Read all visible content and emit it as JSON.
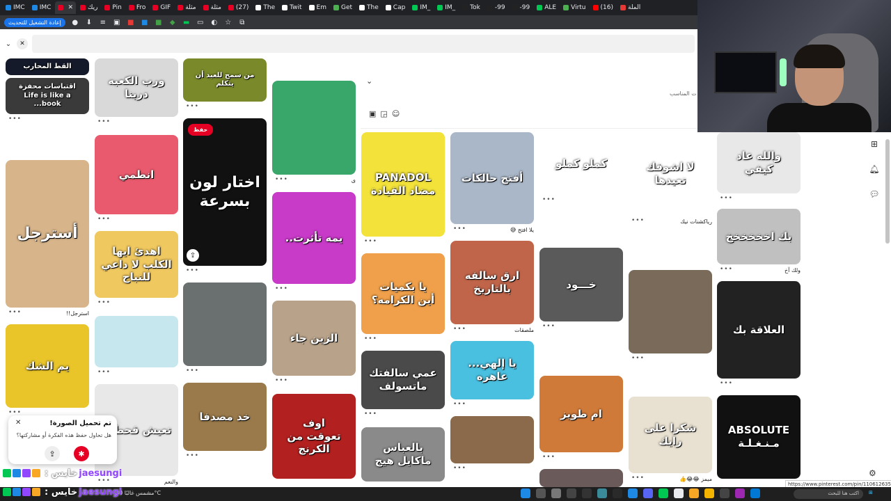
{
  "browser": {
    "tabs": [
      {
        "label": "الملة",
        "fav": "#e53935"
      },
      {
        "label": "(16)",
        "fav": "#ff0000"
      },
      {
        "label": "Virtu",
        "fav": "#4caf50"
      },
      {
        "label": "ALE",
        "fav": "#00c853"
      },
      {
        "label": "-99",
        "fav": "#222222"
      },
      {
        "label": "-99",
        "fav": "#222222"
      },
      {
        "label": "Tok",
        "fav": "#222222"
      },
      {
        "label": "IM_",
        "fav": "#00c853"
      },
      {
        "label": "IM_",
        "fav": "#00c853"
      },
      {
        "label": "Cap",
        "fav": "#ffffff"
      },
      {
        "label": "The",
        "fav": "#ffffff"
      },
      {
        "label": "Get",
        "fav": "#4caf50"
      },
      {
        "label": "Em",
        "fav": "#ffffff"
      },
      {
        "label": "Twit",
        "fav": "#ffffff"
      },
      {
        "label": "The",
        "fav": "#ffffff"
      },
      {
        "label": "(27)",
        "fav": "#e60023"
      },
      {
        "label": "مثلة",
        "fav": "#e60023"
      },
      {
        "label": "مثلة",
        "fav": "#e60023"
      },
      {
        "label": "GIF",
        "fav": "#e60023"
      },
      {
        "label": "Fro",
        "fav": "#e60023"
      },
      {
        "label": "Pin",
        "fav": "#e60023"
      },
      {
        "label": "ريك",
        "fav": "#e60023"
      },
      {
        "label": "",
        "fav": "#e60023",
        "active": true
      },
      {
        "label": "IMC",
        "fav": "#1e88e5"
      },
      {
        "label": "IMC",
        "fav": "#1e88e5"
      }
    ],
    "relaunch_label": "إعادة التشغيل للتحديث"
  },
  "comment_panel": {
    "hint": "ت المناسب"
  },
  "pins": [
    {
      "caption": "القط المحارب",
      "bg": "#151a2a",
      "title": ""
    },
    {
      "caption": "اقتباسات محفزة\nLife is like a book...",
      "bg": "#3a3a3a",
      "title": ""
    },
    {
      "caption": "أسترجل",
      "bg": "#d7b48a",
      "title": "استرجل!!"
    },
    {
      "caption": "يم الشك",
      "bg": "#e9c52a",
      "title": ""
    },
    {
      "caption": "ورب الكعبه درينا",
      "bg": "#d9d9d9",
      "title": ""
    },
    {
      "caption": "انطمي",
      "bg": "#ea5a6e",
      "title": ""
    },
    {
      "caption": "اهدئ ايها الكلب لا داعي للنباح",
      "bg": "#f0c860",
      "title": ""
    },
    {
      "caption": "",
      "bg": "#c7e7ef",
      "title": ""
    },
    {
      "caption": "تعيش قحطان",
      "bg": "#e8e8e8",
      "title": "والنعم"
    },
    {
      "caption": "من سمح للعبد أن يتكلم",
      "bg": "#7a8a2a",
      "title": ""
    },
    {
      "caption": "اختار لون بسرعة",
      "bg": "#111111",
      "title": ""
    },
    {
      "caption": "",
      "bg": "#6a7070",
      "title": ""
    },
    {
      "caption": "خد مصدفا",
      "bg": "#9a7a4a",
      "title": ""
    },
    {
      "caption": "",
      "bg": "#3aa76a",
      "title": "ى"
    },
    {
      "caption": "يمه تأثرت..",
      "bg": "#c83ac8",
      "title": ""
    },
    {
      "caption": "الزين جاء",
      "bg": "#b8a38a",
      "title": ""
    },
    {
      "caption": "اوف\nتعوقت من الكرنج",
      "bg": "#b32020",
      "title": ""
    },
    {
      "caption": "PANADOL\nمضاد القيادة",
      "bg": "#f2e23a",
      "title": ""
    },
    {
      "caption": "يا بكميات\nأين الكرامه؟",
      "bg": "#f0a04a",
      "title": ""
    },
    {
      "caption": "عمي سالفتك ماتسولف",
      "bg": "#4a4a4a",
      "title": ""
    },
    {
      "caption": "بالعباس ماكايل هيج",
      "bg": "#8a8a8a",
      "title": ""
    },
    {
      "caption": "أفتح حالكات",
      "bg": "#a9b7c8",
      "title": "يلا افتح 😅"
    },
    {
      "caption": "ارق سالفه بالتاريخ",
      "bg": "#c0654a",
      "title": "ملصقات"
    },
    {
      "caption": "يا إلهي... عاهره",
      "bg": "#4ac0e0",
      "title": ""
    },
    {
      "caption": "",
      "bg": "#8a6a4a",
      "title": ""
    },
    {
      "caption": "كملو كملو",
      "bg": "#ffffff",
      "title": ""
    },
    {
      "caption": "خـــود",
      "bg": "#5a5a5a",
      "title": ""
    },
    {
      "caption": "ام طويز",
      "bg": "#d07a3a",
      "title": ""
    },
    {
      "caption": "",
      "bg": "#6a5a5a",
      "title": ""
    },
    {
      "caption": "لا اشوفك تعيدها",
      "bg": "#ffffff",
      "title": "رياكشنات نيك"
    },
    {
      "caption": "",
      "bg": "#7a6a5a",
      "title": ""
    },
    {
      "caption": "شكرا على رايك",
      "bg": "#e8e0d0",
      "title": "ميمز 😂😂👍"
    },
    {
      "caption": "والله عاد كيفي",
      "bg": "#e8e8e8",
      "title": ""
    },
    {
      "caption": "بك اخخخخخخ",
      "bg": "#c0c0c0",
      "title": "ولك آخ"
    },
    {
      "caption": "العلاقة بك",
      "bg": "#222222",
      "title": ""
    },
    {
      "caption": "ABSOLUTE\nمـنـغـلـة",
      "bg": "#111111",
      "title": ""
    }
  ],
  "save_label": "حفظ",
  "toast": {
    "title": "تم تحميل الصورة!",
    "subtitle": "هل تحاول حفظ هذه الفكرة أو مشاركتها؟"
  },
  "chat": [
    {
      "name": "خايس :",
      "user": "jaesungi"
    },
    {
      "name": "خايس :",
      "user": "jaesungi"
    }
  ],
  "taskbar": {
    "weather": "مشمس غالبًا 30°C",
    "search_placeholder": "اكتب هنا للبحث"
  },
  "url_tooltip": "https://www.pinterest.com/pin/1106126358487242344/",
  "colors": {
    "accent": "#e60023",
    "chat_user": "#9146ff",
    "browser_dark": "#202124"
  }
}
